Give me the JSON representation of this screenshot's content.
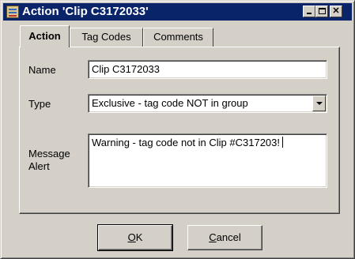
{
  "window": {
    "title": "Action 'Clip C3172033'",
    "icon": "tag-editor-app-icon"
  },
  "tabs": [
    {
      "label": "Action",
      "active": true
    },
    {
      "label": "Tag Codes",
      "active": false
    },
    {
      "label": "Comments",
      "active": false
    }
  ],
  "form": {
    "name_label": "Name",
    "name_value": "Clip C3172033",
    "type_label": "Type",
    "type_value": "Exclusive - tag code NOT in group",
    "message_label_line1": "Message",
    "message_label_line2": "Alert",
    "message_value": "Warning - tag code not in Clip #C317203!"
  },
  "buttons": {
    "ok_mnemonic": "O",
    "ok_rest": "K",
    "cancel_mnemonic": "C",
    "cancel_rest": "ancel"
  },
  "colors": {
    "titlebar": "#0a246a",
    "face": "#d4d0c8"
  }
}
